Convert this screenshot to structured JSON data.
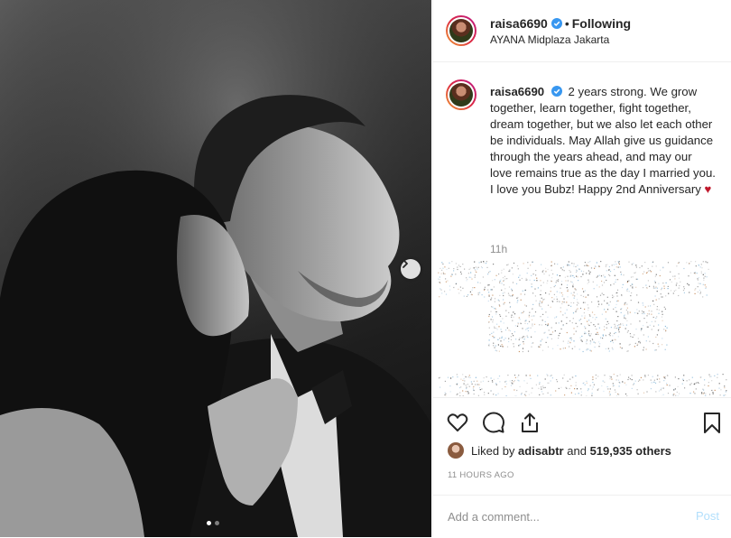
{
  "header": {
    "username": "raisa6690",
    "separator": "•",
    "follow_label": "Following",
    "location": "AYANA Midplaza Jakarta"
  },
  "caption": {
    "username": "raisa6690",
    "text": "2 years strong. We grow together, learn together, fight together, dream together, but we also let each other be individuals. May Allah give us guidance through the years ahead, and may our love remains true as the day I married you. I love you Bubz! Happy 2nd Anniversary",
    "emoji": "♥",
    "time": "11h"
  },
  "actions": {
    "icons": [
      "heart-icon",
      "comment-icon",
      "share-icon",
      "bookmark-icon"
    ],
    "liked_by_prefix": "Liked by",
    "liked_by_user": "adisabtr",
    "liked_by_and": "and",
    "liked_by_count": "519,935 others",
    "posted_ago": "11 HOURS AGO"
  },
  "comment_box": {
    "placeholder": "Add a comment...",
    "post_label": "Post"
  },
  "carousel": {
    "slide_count": 2,
    "active_index": 0
  },
  "colors": {
    "verified": "#3897f0",
    "post_button": "#b2dffc",
    "heart_emoji": "#c0182c"
  }
}
